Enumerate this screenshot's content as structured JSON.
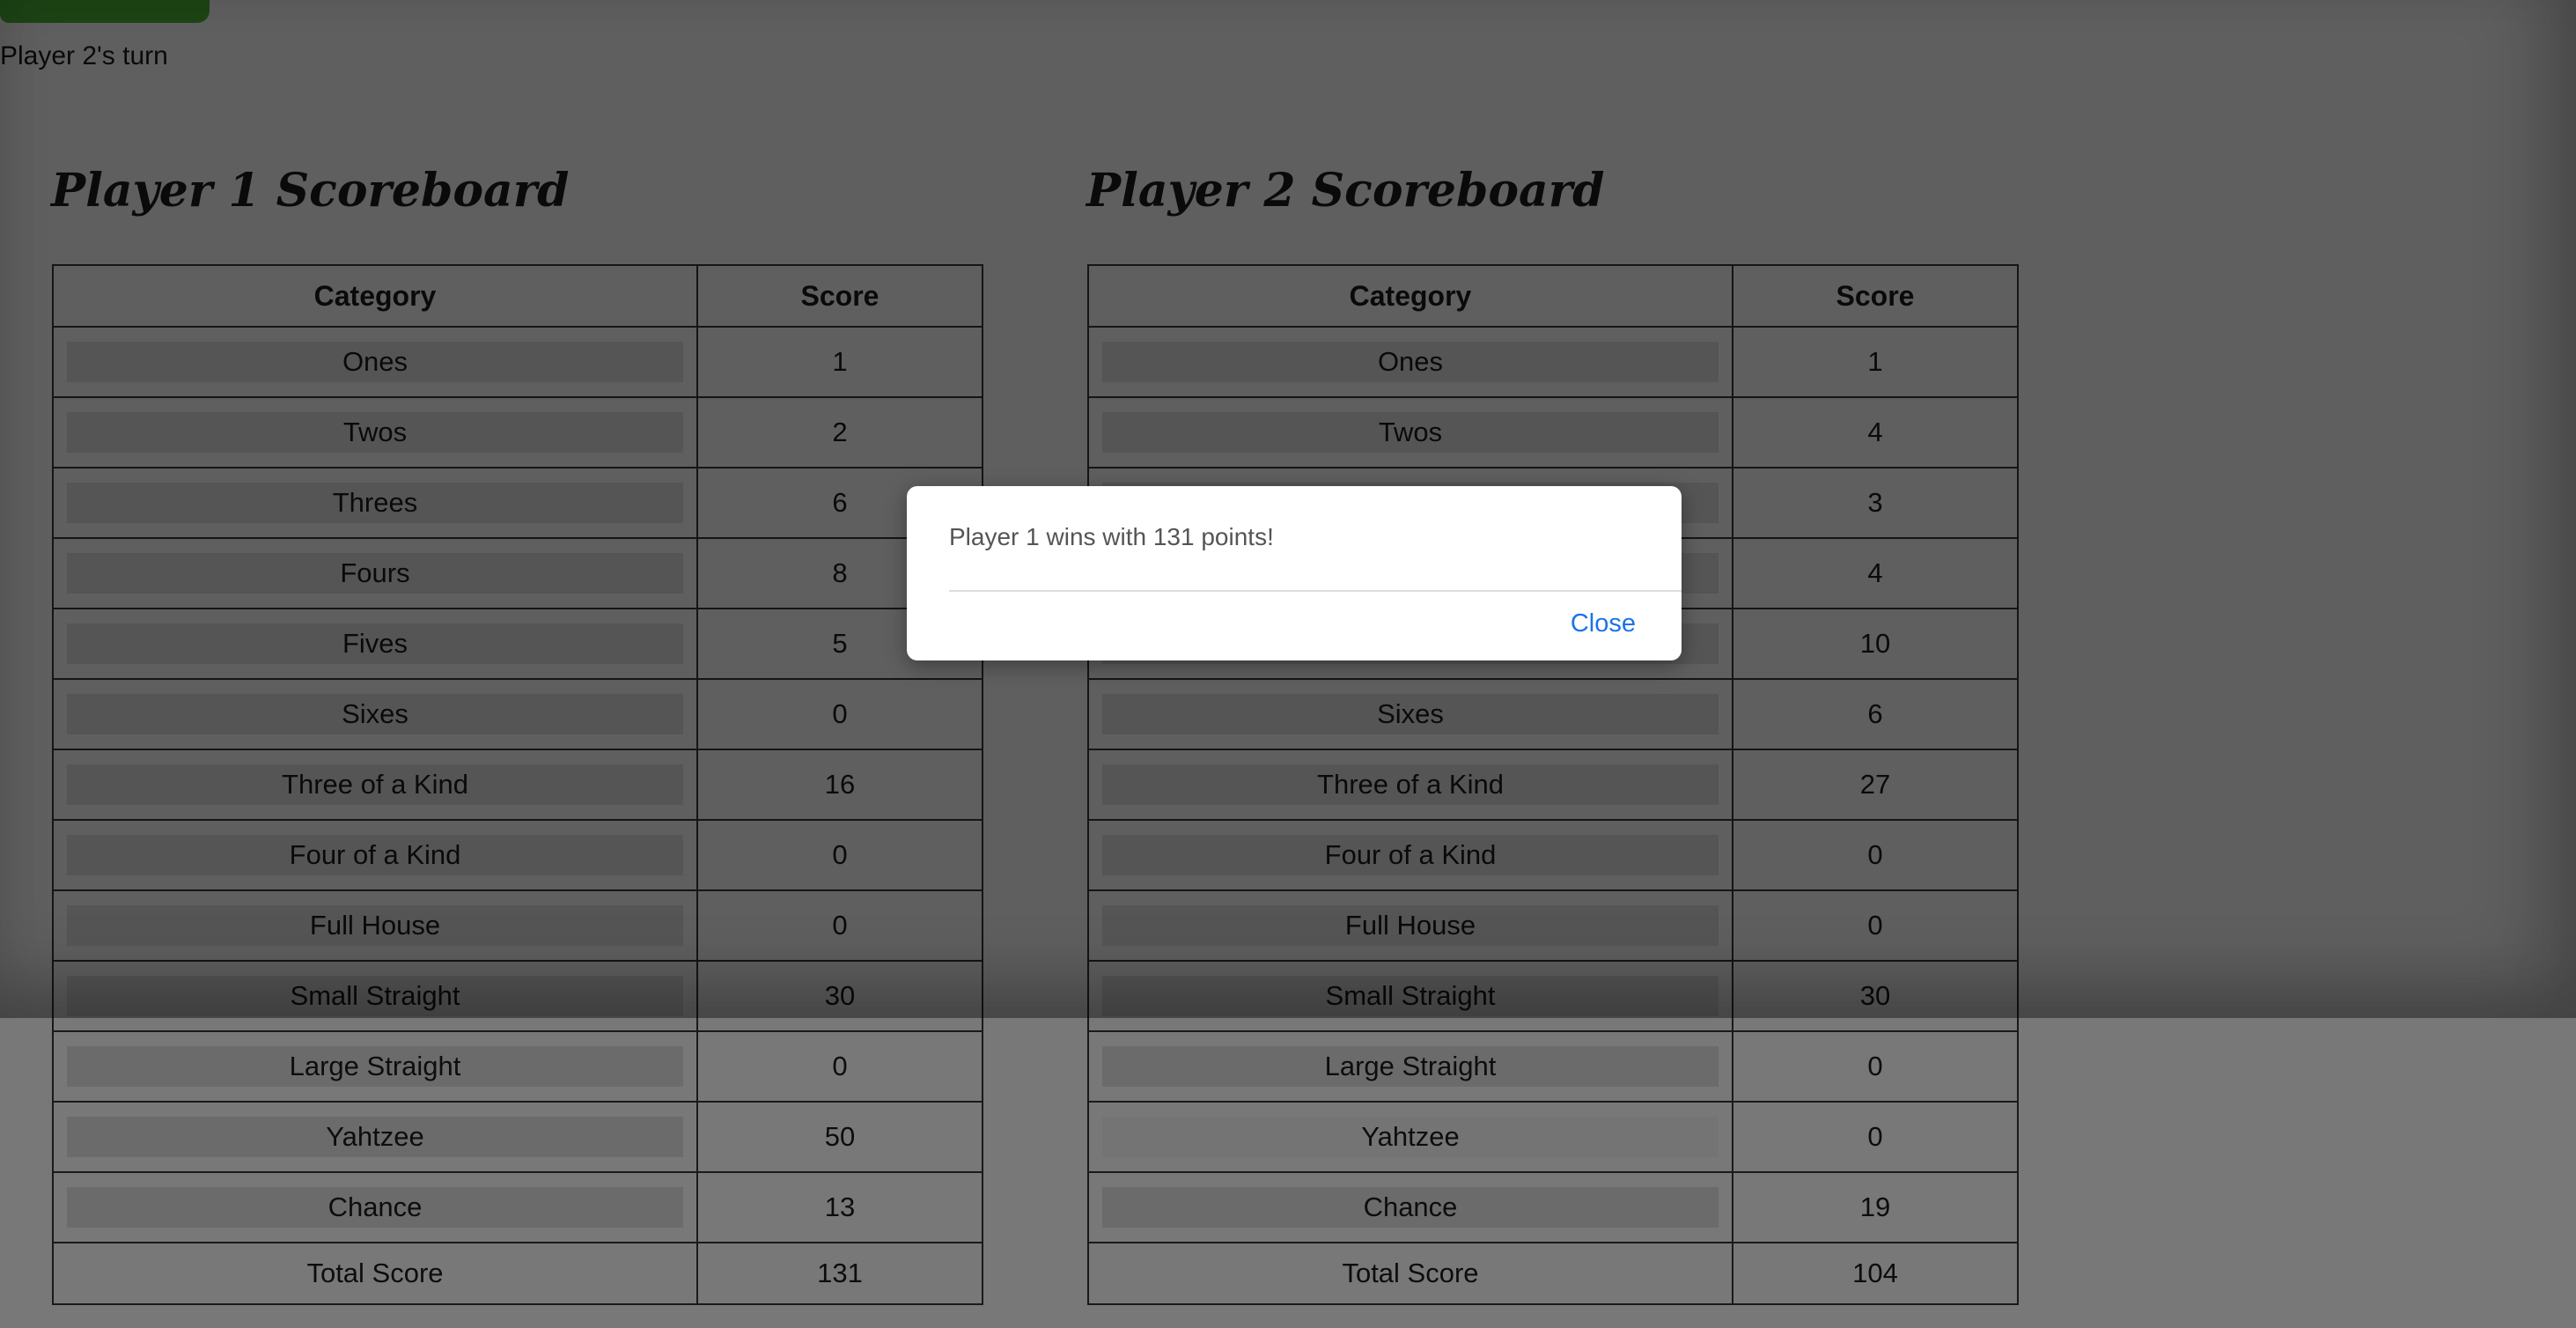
{
  "status": {
    "turn_text": "Player 2's turn"
  },
  "columns": {
    "category": "Category",
    "score": "Score"
  },
  "player1": {
    "title": "Player 1 Scoreboard",
    "rows": [
      {
        "category": "Ones",
        "score": "1"
      },
      {
        "category": "Twos",
        "score": "2"
      },
      {
        "category": "Threes",
        "score": "6"
      },
      {
        "category": "Fours",
        "score": "8"
      },
      {
        "category": "Fives",
        "score": "5"
      },
      {
        "category": "Sixes",
        "score": "0"
      },
      {
        "category": "Three of a Kind",
        "score": "16"
      },
      {
        "category": "Four of a Kind",
        "score": "0"
      },
      {
        "category": "Full House",
        "score": "0"
      },
      {
        "category": "Small Straight",
        "score": "30"
      },
      {
        "category": "Large Straight",
        "score": "0"
      },
      {
        "category": "Yahtzee",
        "score": "50"
      },
      {
        "category": "Chance",
        "score": "13"
      }
    ],
    "total_label": "Total Score",
    "total_value": "131"
  },
  "player2": {
    "title": "Player 2 Scoreboard",
    "rows": [
      {
        "category": "Ones",
        "score": "1"
      },
      {
        "category": "Twos",
        "score": "4"
      },
      {
        "category": "",
        "score": "3"
      },
      {
        "category": "",
        "score": "4"
      },
      {
        "category": "",
        "score": "10"
      },
      {
        "category": "Sixes",
        "score": "6"
      },
      {
        "category": "Three of a Kind",
        "score": "27"
      },
      {
        "category": "Four of a Kind",
        "score": "0"
      },
      {
        "category": "Full House",
        "score": "0"
      },
      {
        "category": "Small Straight",
        "score": "30"
      },
      {
        "category": "Large Straight",
        "score": "0"
      },
      {
        "category": "Yahtzee",
        "score": "0"
      },
      {
        "category": "Chance",
        "score": "19"
      }
    ],
    "total_label": "Total Score",
    "total_value": "104"
  },
  "modal": {
    "message": "Player 1 wins with 131 points!",
    "close_label": "Close"
  },
  "colors": {
    "top_button": "#2f6f22",
    "close_link": "#1a73e8"
  }
}
